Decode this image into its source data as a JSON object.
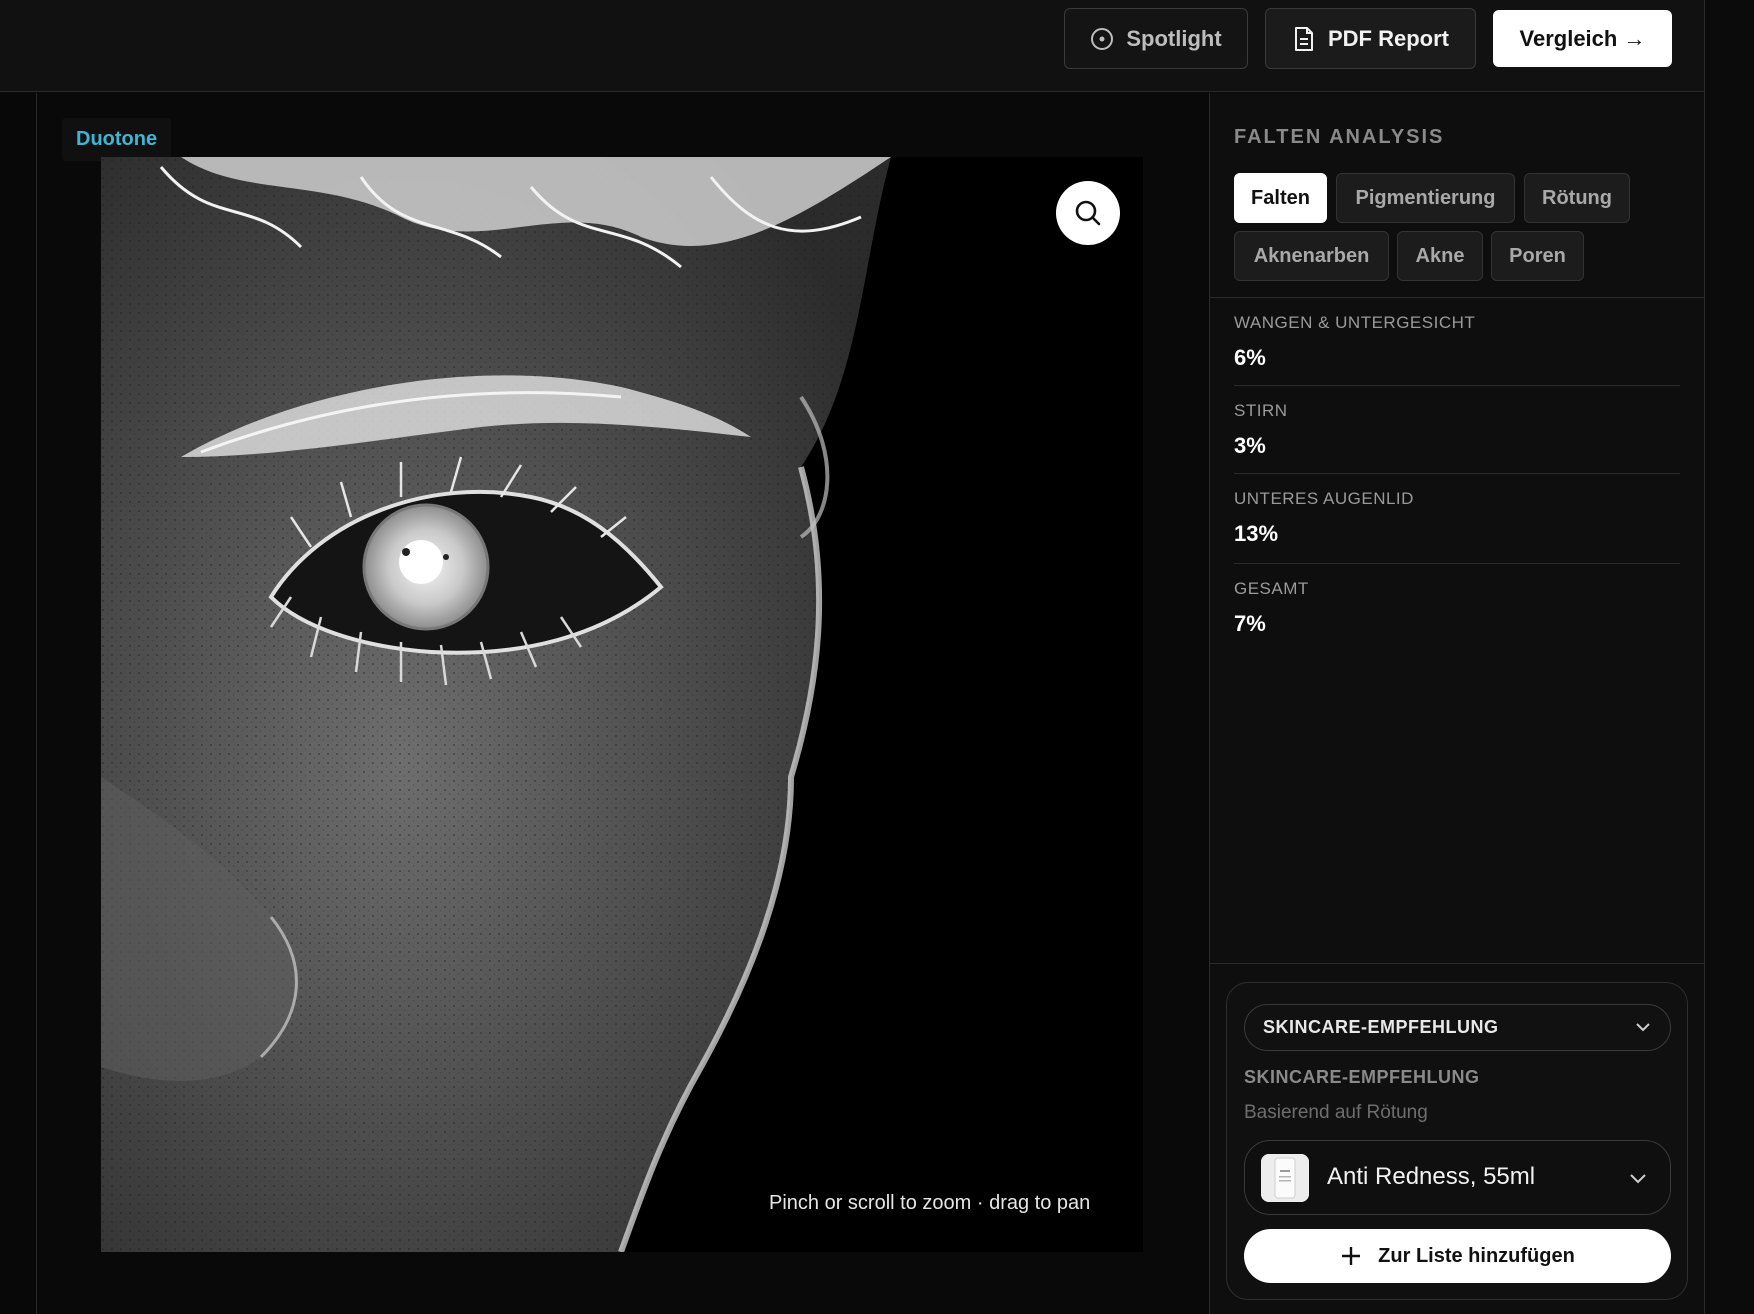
{
  "header": {
    "spotlight_label": "Spotlight",
    "pdf_label": "PDF Report",
    "compare_label": "Vergleich →"
  },
  "viewer": {
    "mode_label": "Duotone",
    "zoom_hint": "Pinch or scroll to zoom · drag to pan",
    "accent_color": "#3fb5d6"
  },
  "panel": {
    "title": "FALTEN ANALYSIS",
    "chips": [
      {
        "label": "Falten",
        "active": true
      },
      {
        "label": "Pigmentierung",
        "active": false
      },
      {
        "label": "Rötung",
        "active": false
      },
      {
        "label": "Aknenarben",
        "active": false
      },
      {
        "label": "Akne",
        "active": false
      },
      {
        "label": "Poren",
        "active": false
      }
    ],
    "metrics": [
      {
        "label": "WANGEN & UNTERGESICHT",
        "value": "6%"
      },
      {
        "label": "STIRN",
        "value": "3%"
      },
      {
        "label": "UNTERES AUGENLID",
        "value": "13%"
      },
      {
        "label": "GESAMT",
        "value": "7%"
      }
    ]
  },
  "recommendation": {
    "select_label": "SKINCARE-EMPFEHLUNG",
    "title": "SKINCARE-EMPFEHLUNG",
    "subtitle": "Basierend auf Rötung",
    "product": "Anti Redness, 55ml",
    "add_label": "Zur Liste hinzufügen"
  }
}
